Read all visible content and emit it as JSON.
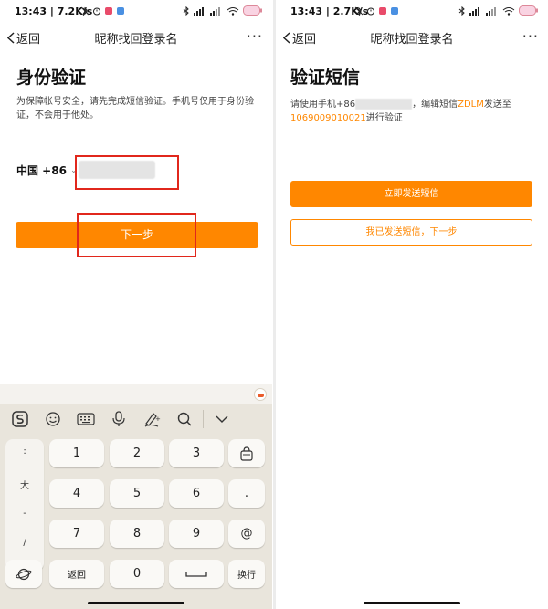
{
  "left": {
    "status": {
      "time": "13:43",
      "speed": "7.2K/s"
    },
    "nav": {
      "back_label": "返回",
      "title": "昵称找回登录名",
      "more": "···"
    },
    "heading": "身份验证",
    "description": "为保障帐号安全，请先完成短信验证。手机号仅用于身份验证，不会用于他处。",
    "country": {
      "label": "中国 +86",
      "caret": "⌄"
    },
    "phone": {
      "value": ""
    },
    "next_button": "下一步",
    "keyboard": {
      "toolbar": [
        "sogou-logo-icon",
        "emoji-icon",
        "keyboard-icon",
        "microphone-icon",
        "handwriting-icon",
        "search-icon",
        "collapse-icon"
      ],
      "side_symbols": [
        ":",
        "大",
        "-",
        "/"
      ],
      "rows": [
        [
          "1",
          "2",
          "3"
        ],
        [
          "4",
          "5",
          "6"
        ],
        [
          "7",
          "8",
          "9"
        ]
      ],
      "right_keys": [
        "clipboard-icon",
        ".",
        "@"
      ],
      "bottom": {
        "back_label": "返回",
        "zero": "0",
        "space": "space-icon",
        "newline_label": "换行"
      },
      "accent": "#e9e5dc"
    }
  },
  "right": {
    "status": {
      "time": "13:43",
      "speed": "2.7K/s"
    },
    "nav": {
      "back_label": "返回",
      "title": "昵称找回登录名",
      "more": "···"
    },
    "heading": "验证短信",
    "sms": {
      "prefix": "请使用手机+86",
      "middle": "，编辑短信",
      "code": "ZDLM",
      "middle2": "发送至",
      "number": "1069009010021",
      "suffix": "进行验证"
    },
    "send_button": "立即发送短信",
    "sent_next_button": "我已发送短信，下一步"
  },
  "colors": {
    "accent": "#ff8700",
    "highlight": "#e1271c"
  }
}
